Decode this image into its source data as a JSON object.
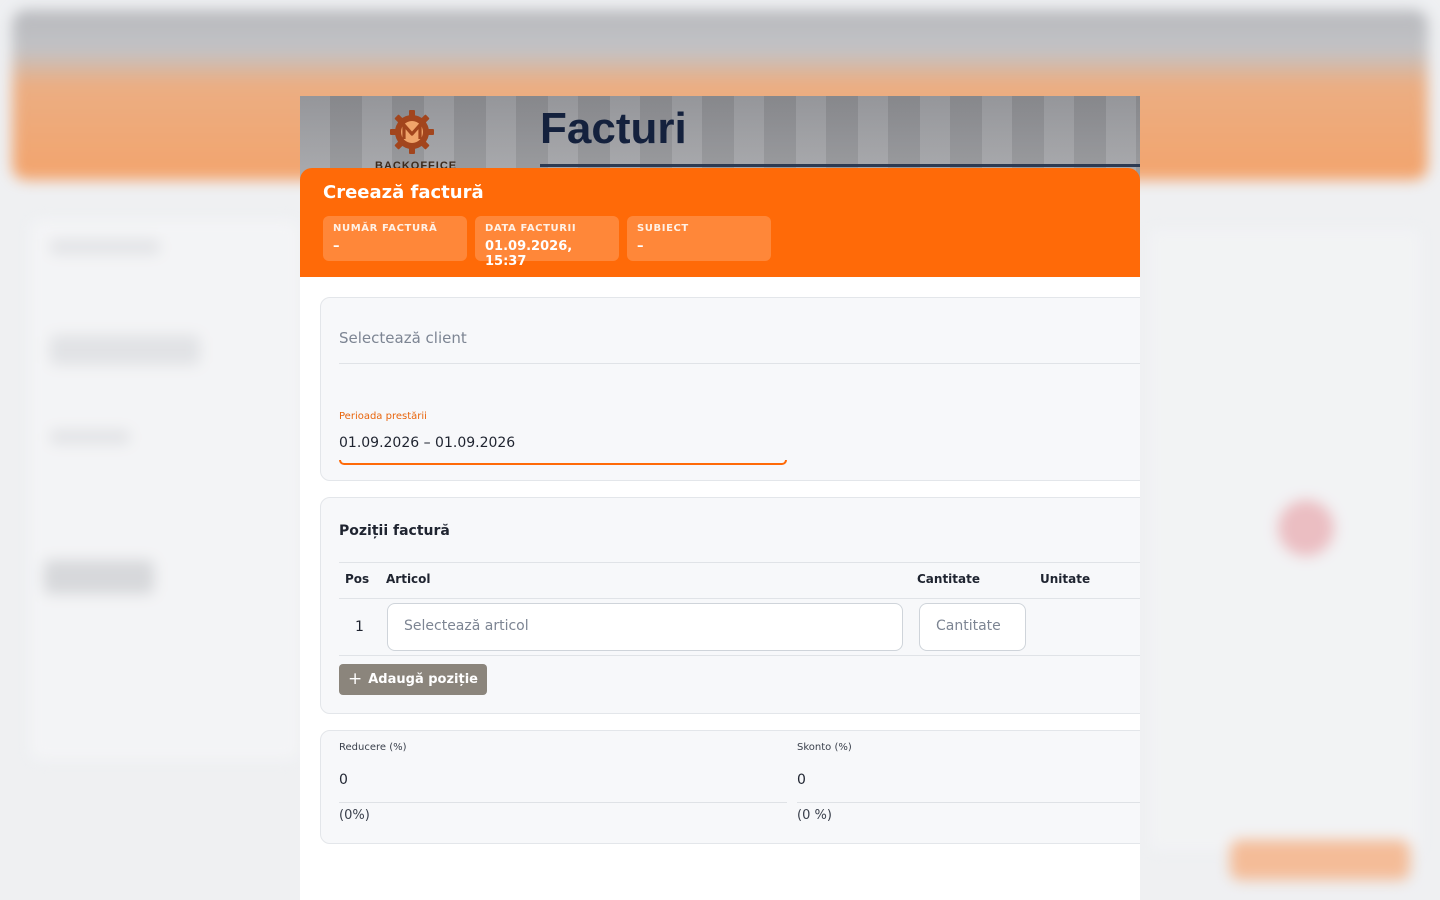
{
  "background": {
    "accent": "#ff6a08"
  },
  "banner": {
    "logo_icon": "gear-m-logo",
    "logo_text": "BACKOFFICE",
    "title": "Facturi"
  },
  "dialog": {
    "title": "Creează factură",
    "chips": [
      {
        "label": "NUMĂR FACTURĂ",
        "value": "–"
      },
      {
        "label": "DATA FACTURII",
        "value": "01.09.2026, 15:37"
      },
      {
        "label": "SUBIECT",
        "value": "–"
      }
    ]
  },
  "client": {
    "placeholder": "Selectează client"
  },
  "period": {
    "label": "Perioada prestării",
    "value": "01.09.2026 – 01.09.2026"
  },
  "positions": {
    "title": "Poziții factură",
    "columns": [
      "Pos",
      "Articol",
      "Cantitate",
      "Unitate"
    ],
    "rows": [
      {
        "pos": "1",
        "article_placeholder": "Selectează articol",
        "quantity_placeholder": "Cantitate"
      }
    ],
    "add_button": "Adaugă poziție"
  },
  "discounts": {
    "reducere": {
      "label": "Reducere (%)",
      "value": "0",
      "hint": "(0%)"
    },
    "skonto": {
      "label": "Skonto (%)",
      "value": "0",
      "hint": "(0 %)"
    }
  }
}
